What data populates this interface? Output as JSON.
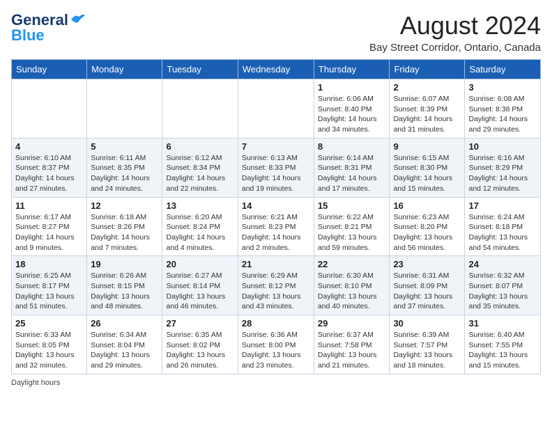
{
  "header": {
    "logo_general": "General",
    "logo_blue": "Blue",
    "title": "August 2024",
    "subtitle": "Bay Street Corridor, Ontario, Canada"
  },
  "days_of_week": [
    "Sunday",
    "Monday",
    "Tuesday",
    "Wednesday",
    "Thursday",
    "Friday",
    "Saturday"
  ],
  "weeks": [
    [
      {
        "day": "",
        "info": ""
      },
      {
        "day": "",
        "info": ""
      },
      {
        "day": "",
        "info": ""
      },
      {
        "day": "",
        "info": ""
      },
      {
        "day": "1",
        "info": "Sunrise: 6:06 AM\nSunset: 8:40 PM\nDaylight: 14 hours and 34 minutes."
      },
      {
        "day": "2",
        "info": "Sunrise: 6:07 AM\nSunset: 8:39 PM\nDaylight: 14 hours and 31 minutes."
      },
      {
        "day": "3",
        "info": "Sunrise: 6:08 AM\nSunset: 8:38 PM\nDaylight: 14 hours and 29 minutes."
      }
    ],
    [
      {
        "day": "4",
        "info": "Sunrise: 6:10 AM\nSunset: 8:37 PM\nDaylight: 14 hours and 27 minutes."
      },
      {
        "day": "5",
        "info": "Sunrise: 6:11 AM\nSunset: 8:35 PM\nDaylight: 14 hours and 24 minutes."
      },
      {
        "day": "6",
        "info": "Sunrise: 6:12 AM\nSunset: 8:34 PM\nDaylight: 14 hours and 22 minutes."
      },
      {
        "day": "7",
        "info": "Sunrise: 6:13 AM\nSunset: 8:33 PM\nDaylight: 14 hours and 19 minutes."
      },
      {
        "day": "8",
        "info": "Sunrise: 6:14 AM\nSunset: 8:31 PM\nDaylight: 14 hours and 17 minutes."
      },
      {
        "day": "9",
        "info": "Sunrise: 6:15 AM\nSunset: 8:30 PM\nDaylight: 14 hours and 15 minutes."
      },
      {
        "day": "10",
        "info": "Sunrise: 6:16 AM\nSunset: 8:29 PM\nDaylight: 14 hours and 12 minutes."
      }
    ],
    [
      {
        "day": "11",
        "info": "Sunrise: 6:17 AM\nSunset: 8:27 PM\nDaylight: 14 hours and 9 minutes."
      },
      {
        "day": "12",
        "info": "Sunrise: 6:18 AM\nSunset: 8:26 PM\nDaylight: 14 hours and 7 minutes."
      },
      {
        "day": "13",
        "info": "Sunrise: 6:20 AM\nSunset: 8:24 PM\nDaylight: 14 hours and 4 minutes."
      },
      {
        "day": "14",
        "info": "Sunrise: 6:21 AM\nSunset: 8:23 PM\nDaylight: 14 hours and 2 minutes."
      },
      {
        "day": "15",
        "info": "Sunrise: 6:22 AM\nSunset: 8:21 PM\nDaylight: 13 hours and 59 minutes."
      },
      {
        "day": "16",
        "info": "Sunrise: 6:23 AM\nSunset: 8:20 PM\nDaylight: 13 hours and 56 minutes."
      },
      {
        "day": "17",
        "info": "Sunrise: 6:24 AM\nSunset: 8:18 PM\nDaylight: 13 hours and 54 minutes."
      }
    ],
    [
      {
        "day": "18",
        "info": "Sunrise: 6:25 AM\nSunset: 8:17 PM\nDaylight: 13 hours and 51 minutes."
      },
      {
        "day": "19",
        "info": "Sunrise: 6:26 AM\nSunset: 8:15 PM\nDaylight: 13 hours and 48 minutes."
      },
      {
        "day": "20",
        "info": "Sunrise: 6:27 AM\nSunset: 8:14 PM\nDaylight: 13 hours and 46 minutes."
      },
      {
        "day": "21",
        "info": "Sunrise: 6:29 AM\nSunset: 8:12 PM\nDaylight: 13 hours and 43 minutes."
      },
      {
        "day": "22",
        "info": "Sunrise: 6:30 AM\nSunset: 8:10 PM\nDaylight: 13 hours and 40 minutes."
      },
      {
        "day": "23",
        "info": "Sunrise: 6:31 AM\nSunset: 8:09 PM\nDaylight: 13 hours and 37 minutes."
      },
      {
        "day": "24",
        "info": "Sunrise: 6:32 AM\nSunset: 8:07 PM\nDaylight: 13 hours and 35 minutes."
      }
    ],
    [
      {
        "day": "25",
        "info": "Sunrise: 6:33 AM\nSunset: 8:05 PM\nDaylight: 13 hours and 32 minutes."
      },
      {
        "day": "26",
        "info": "Sunrise: 6:34 AM\nSunset: 8:04 PM\nDaylight: 13 hours and 29 minutes."
      },
      {
        "day": "27",
        "info": "Sunrise: 6:35 AM\nSunset: 8:02 PM\nDaylight: 13 hours and 26 minutes."
      },
      {
        "day": "28",
        "info": "Sunrise: 6:36 AM\nSunset: 8:00 PM\nDaylight: 13 hours and 23 minutes."
      },
      {
        "day": "29",
        "info": "Sunrise: 6:37 AM\nSunset: 7:58 PM\nDaylight: 13 hours and 21 minutes."
      },
      {
        "day": "30",
        "info": "Sunrise: 6:39 AM\nSunset: 7:57 PM\nDaylight: 13 hours and 18 minutes."
      },
      {
        "day": "31",
        "info": "Sunrise: 6:40 AM\nSunset: 7:55 PM\nDaylight: 13 hours and 15 minutes."
      }
    ]
  ],
  "footer": {
    "daylight_label": "Daylight hours"
  }
}
